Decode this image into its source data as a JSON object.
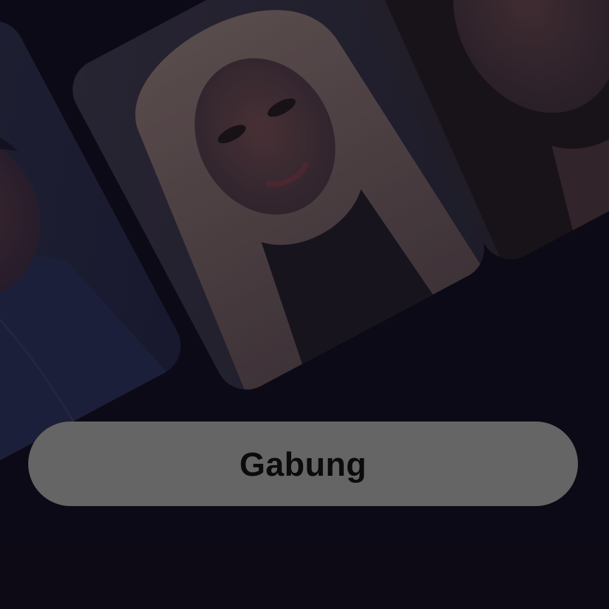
{
  "join_button": {
    "label": "Gabung"
  },
  "colors": {
    "background": "#0d0a17",
    "button_background": "#656565",
    "button_text": "#0b0b0b"
  },
  "photos": [
    {
      "name": "profile-photo-man"
    },
    {
      "name": "profile-photo-woman-blonde"
    },
    {
      "name": "profile-photo-woman-brunette"
    }
  ]
}
